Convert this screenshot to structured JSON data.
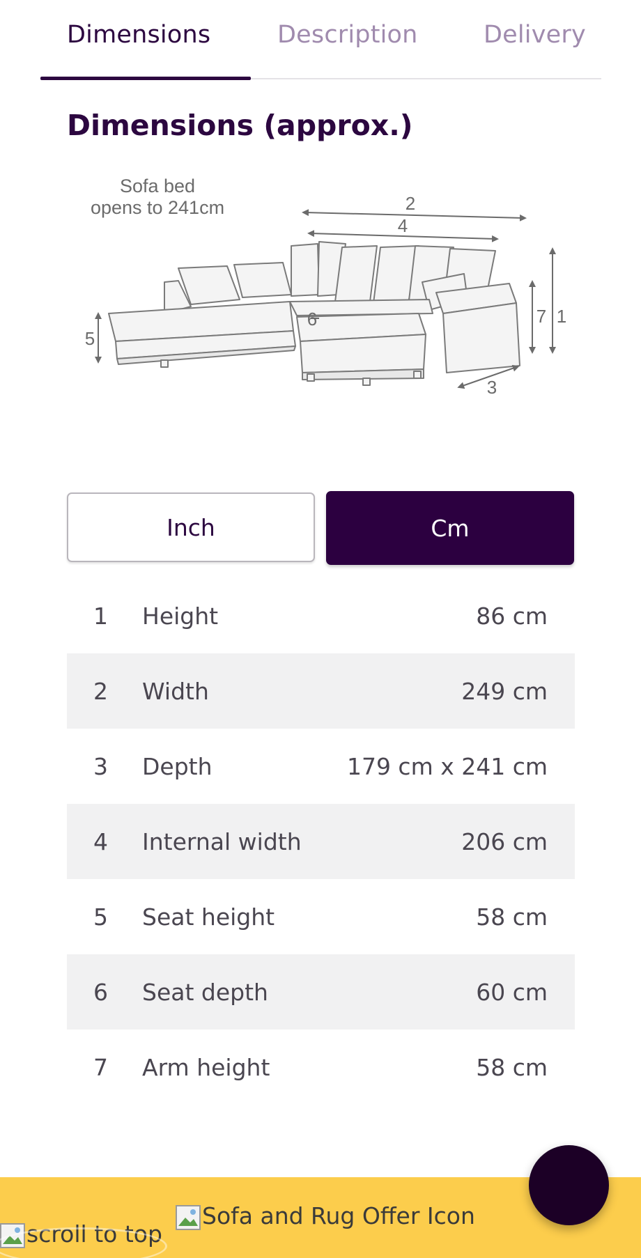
{
  "tabs": [
    {
      "label": "Dimensions",
      "active": true
    },
    {
      "label": "Description",
      "active": false
    },
    {
      "label": "Delivery",
      "active": false
    }
  ],
  "section_title": "Dimensions (approx.)",
  "diagram": {
    "note_line1": "Sofa bed",
    "note_line2": "opens to 241cm",
    "markers": [
      "1",
      "2",
      "3",
      "4",
      "5",
      "6",
      "7"
    ]
  },
  "units": {
    "inch_label": "Inch",
    "cm_label": "Cm",
    "selected": "Cm"
  },
  "dimensions": [
    {
      "num": "1",
      "label": "Height",
      "value": "86 cm"
    },
    {
      "num": "2",
      "label": "Width",
      "value": "249 cm"
    },
    {
      "num": "3",
      "label": "Depth",
      "value": "179 cm x 241 cm"
    },
    {
      "num": "4",
      "label": "Internal width",
      "value": "206 cm"
    },
    {
      "num": "5",
      "label": "Seat height",
      "value": "58 cm"
    },
    {
      "num": "6",
      "label": "Seat depth",
      "value": "60 cm"
    },
    {
      "num": "7",
      "label": "Arm height",
      "value": "58 cm"
    }
  ],
  "banner": {
    "offer_alt": "Sofa and Rug Offer Icon",
    "scroll_alt": "scroll to top"
  },
  "colors": {
    "brand": "#2c0040",
    "banner": "#fccd4c",
    "tab_inactive": "#a08bae",
    "row_stripe": "#f1f1f2"
  }
}
